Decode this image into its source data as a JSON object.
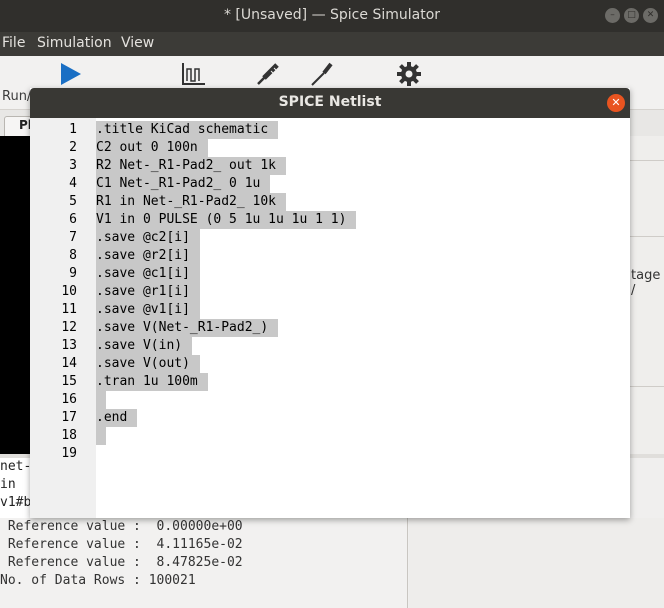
{
  "window": {
    "title": "* [Unsaved] — Spice Simulator"
  },
  "menu": {
    "items": [
      "File",
      "Simulation",
      "View"
    ]
  },
  "toolbar": {
    "icons": [
      "run-icon",
      "plot-icon",
      "probe-icon",
      "tune-icon",
      "settings-icon"
    ],
    "run_label": "Run/",
    "accent": "#1a6fc4"
  },
  "plot_tab": {
    "label": "Pl"
  },
  "right_panel": {
    "label": "tage /"
  },
  "signals": [
    "net-",
    "in",
    "v1#b"
  ],
  "console": {
    "lines": [
      " Reference value :  0.00000e+00",
      " Reference value :  4.11165e-02",
      " Reference value :  8.47825e-02",
      "No. of Data Rows : 100021"
    ]
  },
  "dialog": {
    "title": "SPICE Netlist",
    "lines": [
      ".title KiCad schematic",
      "C2 out 0 100n",
      "R2 Net-_R1-Pad2_ out 1k",
      "C1 Net-_R1-Pad2_ 0 1u",
      "R1 in Net-_R1-Pad2_ 10k",
      "V1 in 0 PULSE (0 5 1u 1u 1u 1 1)",
      ".save @c2[i]",
      ".save @r2[i]",
      ".save @c1[i]",
      ".save @r1[i]",
      ".save @v1[i]",
      ".save V(Net-_R1-Pad2_)",
      ".save V(in)",
      ".save V(out)",
      ".tran 1u 100m",
      "",
      ".end",
      "",
      ""
    ],
    "line_numbers": [
      "1",
      "2",
      "3",
      "4",
      "5",
      "6",
      "7",
      "8",
      "9",
      "10",
      "11",
      "12",
      "13",
      "14",
      "15",
      "16",
      "17",
      "18",
      "19"
    ],
    "close_color": "#e95420"
  }
}
